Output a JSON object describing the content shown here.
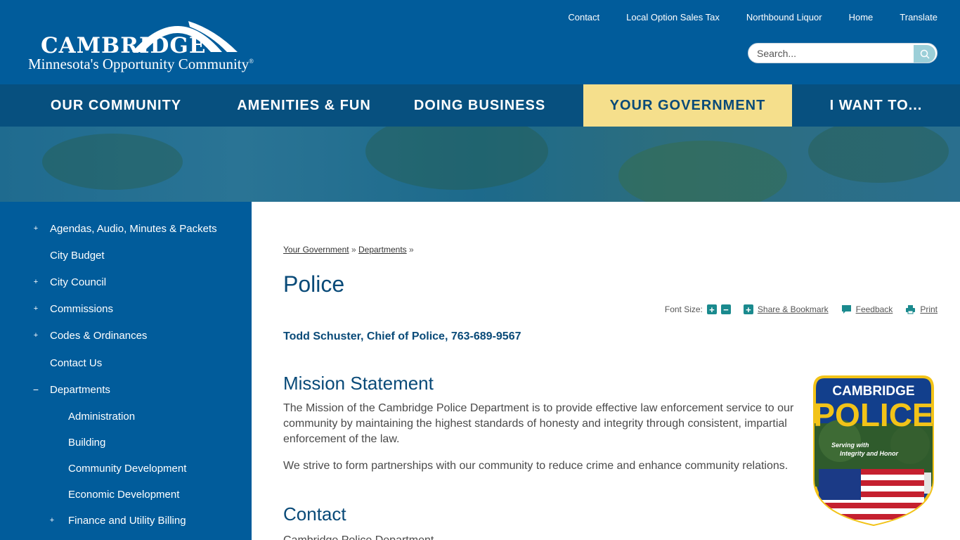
{
  "header": {
    "logo_word": "CAMBRIDGE",
    "logo_tagline": "Minnesota's Opportunity Community",
    "logo_reg": "®",
    "util_links": [
      "Contact",
      "Local Option Sales Tax",
      "Northbound Liquor",
      "Home",
      "Translate"
    ],
    "search_placeholder": "Search..."
  },
  "mainnav": {
    "items": [
      {
        "label": "OUR COMMUNITY"
      },
      {
        "label": "AMENITIES & FUN"
      },
      {
        "label": "DOING BUSINESS"
      },
      {
        "label": "YOUR GOVERNMENT",
        "active": true
      },
      {
        "label": "I WANT TO..."
      }
    ],
    "active_color": "#f5df8c"
  },
  "sidebar": {
    "items": [
      {
        "label": "Agendas, Audio, Minutes & Packets",
        "toggle": "+"
      },
      {
        "label": "City Budget",
        "toggle": ""
      },
      {
        "label": "City Council",
        "toggle": "+"
      },
      {
        "label": "Commissions",
        "toggle": "+"
      },
      {
        "label": "Codes & Ordinances",
        "toggle": "+"
      },
      {
        "label": "Contact Us",
        "toggle": ""
      },
      {
        "label": "Departments",
        "toggle": "−"
      },
      {
        "label": "Administration",
        "toggle": ""
      },
      {
        "label": "Building",
        "toggle": ""
      },
      {
        "label": "Community Development",
        "toggle": ""
      },
      {
        "label": "Economic Development",
        "toggle": ""
      },
      {
        "label": "Finance and Utility Billing",
        "toggle": "+"
      }
    ]
  },
  "content": {
    "breadcrumb": [
      "Your Government",
      "Departments"
    ],
    "breadcrumb_sep": "»",
    "title": "Police",
    "tools": {
      "font_size_label": "Font Size:",
      "increase": "+",
      "decrease": "−",
      "share_label": "Share & Bookmark",
      "feedback_label": "Feedback",
      "print_label": "Print"
    },
    "chief": "Todd Schuster, Chief of Police, 763-689-9567",
    "mission_heading": "Mission Statement",
    "mission_text": "The Mission of the Cambridge Police Department is to provide effective law enforcement service to our community by maintaining the highest standards of honesty and integrity through consistent, impartial enforcement of the law.",
    "mission_text2": "We strive to form partnerships with our community to reduce crime and enhance community relations.",
    "contact_heading": "Contact",
    "contact_line": "Cambridge Police Department"
  },
  "badge": {
    "top": "CAMBRIDGE",
    "main": "POLICE",
    "motto1": "Serving with",
    "motto2": "Integrity and Honor"
  },
  "colors": {
    "brand_blue": "#015c9b",
    "nav_dark": "#07507f",
    "heading": "#094a78",
    "tool_teal": "#1a8a8e"
  }
}
